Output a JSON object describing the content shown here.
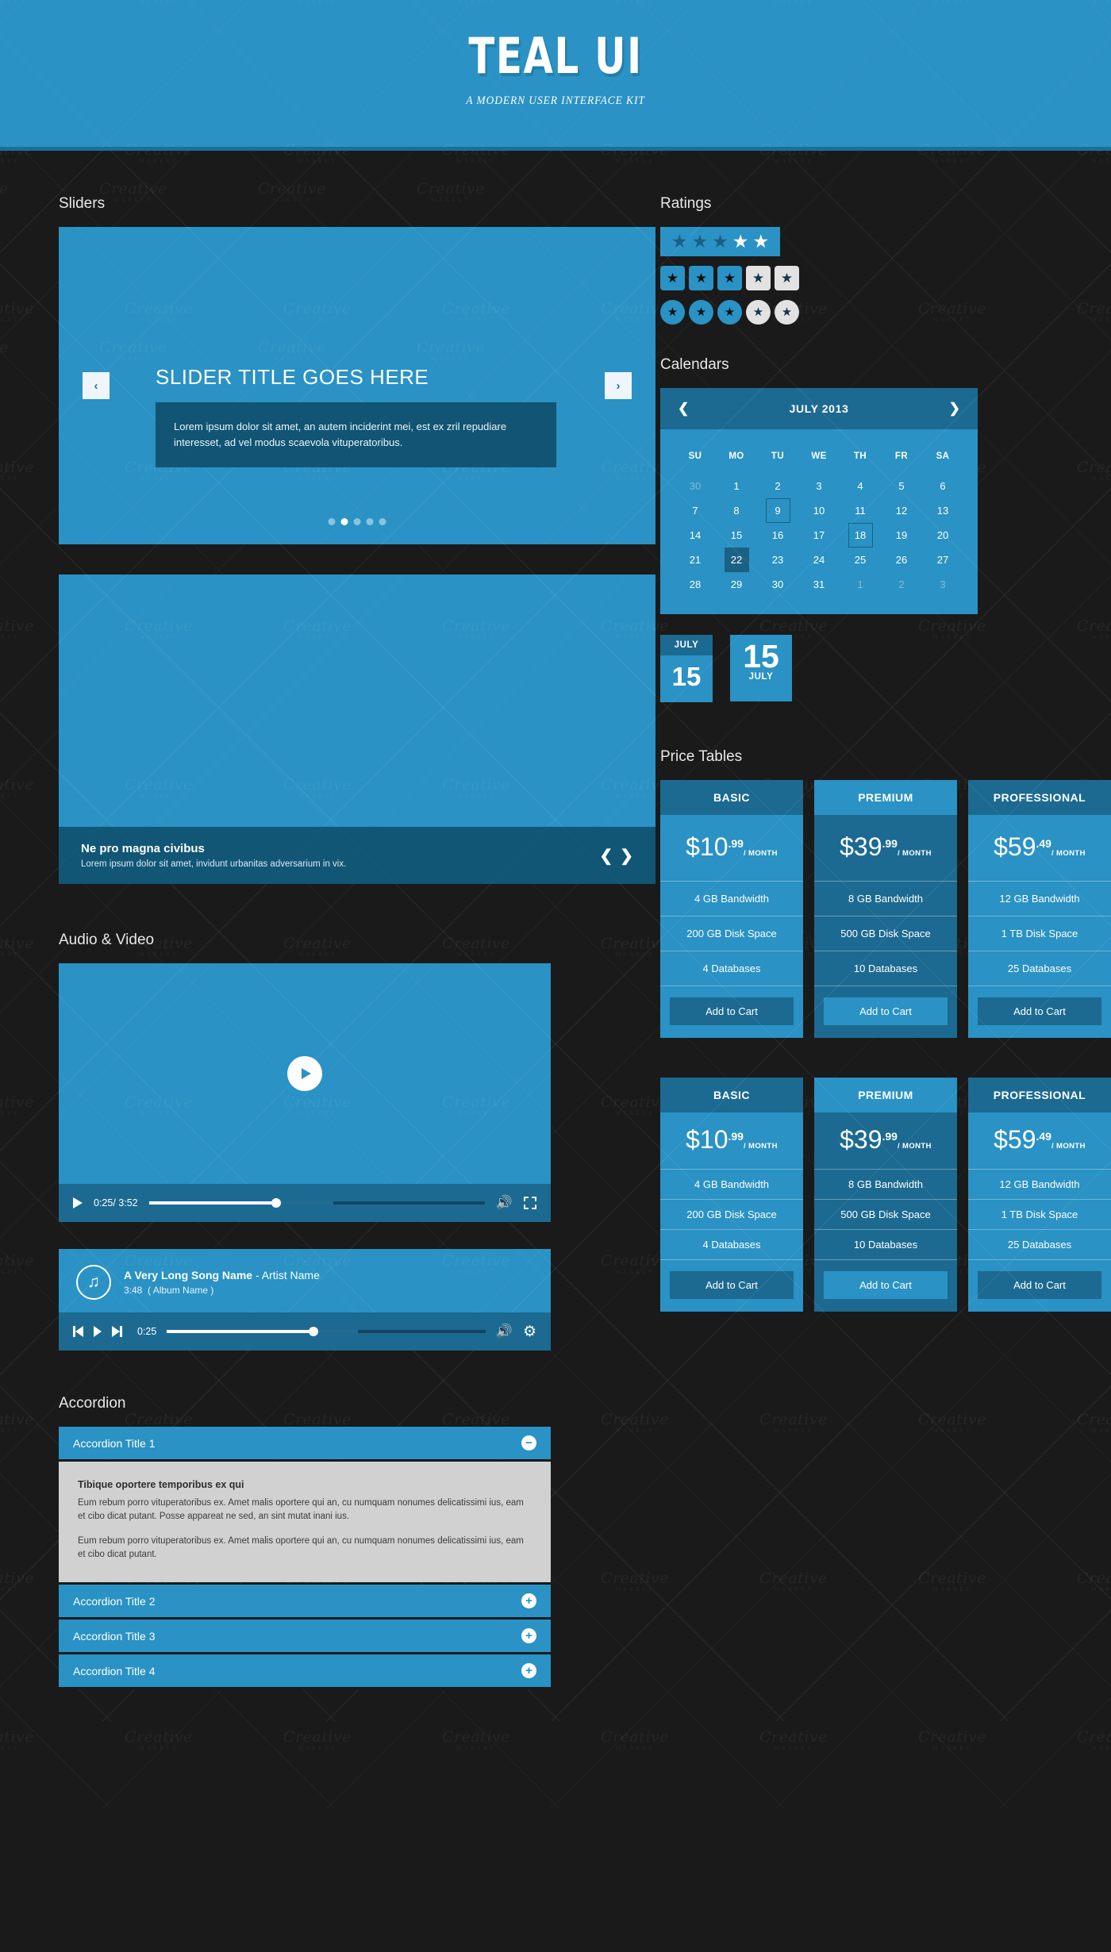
{
  "header": {
    "title": "TEAL UI",
    "subtitle": "A MODERN USER INTERFACE KIT"
  },
  "watermark": {
    "line1": "Creative",
    "line2": "MARKET"
  },
  "colors": {
    "teal": "#2a92c4",
    "teal_dark": "#1c6a91",
    "bg": "#1a1a1a",
    "accordion_body": "#d1d1d1"
  },
  "sections": {
    "sliders": "Sliders",
    "ratings": "Ratings",
    "calendars": "Calendars",
    "audio_video": "Audio & Video",
    "price_tables": "Price Tables",
    "accordion": "Accordion"
  },
  "slider1": {
    "title": "SLIDER TITLE GOES HERE",
    "description": "Lorem ipsum dolor sit amet, an autem inciderint mei, est ex zril repudiare interesset, ad vel modus scaevola vituperatoribus.",
    "prev": "‹",
    "next": "›",
    "dots_count": 5,
    "active_dot": 2
  },
  "slider2": {
    "title": "Ne pro magna civibus",
    "description": "Lorem ipsum dolor sit amet, invidunt urbanitas adversarium in vix.",
    "prev": "❮",
    "next": "❯"
  },
  "ratings": {
    "star_glyph": "★",
    "bar": {
      "total": 5,
      "filled": 3
    },
    "squares": {
      "total": 5,
      "filled": 3
    },
    "circles": {
      "total": 5,
      "filled": 3
    }
  },
  "calendar": {
    "month_label": "JULY 2013",
    "prev": "❮",
    "next": "❯",
    "weekdays": [
      "SU",
      "MO",
      "TU",
      "WE",
      "TH",
      "FR",
      "SA"
    ],
    "weeks": [
      [
        {
          "d": "30",
          "s": "mute"
        },
        {
          "d": "1"
        },
        {
          "d": "2"
        },
        {
          "d": "3"
        },
        {
          "d": "4"
        },
        {
          "d": "5"
        },
        {
          "d": "6"
        }
      ],
      [
        {
          "d": "7"
        },
        {
          "d": "8"
        },
        {
          "d": "9",
          "s": "hov"
        },
        {
          "d": "10"
        },
        {
          "d": "11"
        },
        {
          "d": "12"
        },
        {
          "d": "13"
        }
      ],
      [
        {
          "d": "14"
        },
        {
          "d": "15"
        },
        {
          "d": "16"
        },
        {
          "d": "17"
        },
        {
          "d": "18",
          "s": "hov"
        },
        {
          "d": "19"
        },
        {
          "d": "20"
        }
      ],
      [
        {
          "d": "21"
        },
        {
          "d": "22",
          "s": "sel"
        },
        {
          "d": "23"
        },
        {
          "d": "24"
        },
        {
          "d": "25"
        },
        {
          "d": "26"
        },
        {
          "d": "27"
        }
      ],
      [
        {
          "d": "28"
        },
        {
          "d": "29"
        },
        {
          "d": "30"
        },
        {
          "d": "31"
        },
        {
          "d": "1",
          "s": "mute"
        },
        {
          "d": "2",
          "s": "mute"
        },
        {
          "d": "3",
          "s": "mute"
        }
      ]
    ]
  },
  "date_badges": {
    "badge_a": {
      "month": "JULY",
      "day": "15"
    },
    "badge_b": {
      "day": "15",
      "month": "JULY"
    }
  },
  "video": {
    "play_icon": "play-icon",
    "time": "0:25/ 3:52",
    "progress_percent": 38,
    "buffer_percent": 55,
    "volume_icon": "🔊",
    "fullscreen_icon": "fullscreen-icon"
  },
  "audio": {
    "note_icon": "♫",
    "song_name": "A Very Long Song Name",
    "separator": " - ",
    "artist": "Artist Name",
    "duration": "3:48",
    "album": "( Album Name )",
    "time": "0:25",
    "progress_percent": 46,
    "buffer_percent": 60,
    "volume_icon": "🔊",
    "settings_icon": "⚙"
  },
  "accordion": {
    "items": [
      {
        "title": "Accordion Title 1",
        "sign": "−",
        "open": true
      },
      {
        "title": "Accordion Title 2",
        "sign": "+",
        "open": false
      },
      {
        "title": "Accordion Title 3",
        "sign": "+",
        "open": false
      },
      {
        "title": "Accordion Title 4",
        "sign": "+",
        "open": false
      }
    ],
    "body": {
      "heading": "Tibique oportere temporibus ex qui",
      "p1": "Eum rebum porro vituperatoribus ex. Amet malis oportere qui an, cu numquam nonumes delicatissimi ius, eam et cibo dicat putant. Posse appareat ne sed, an sint mutat inani ius.",
      "p2": "Eum rebum porro vituperatoribus ex. Amet malis oportere qui an, cu numquam nonumes delicatissimi ius, eam et cibo dicat putant."
    }
  },
  "price_tables": {
    "cta": "Add to Cart",
    "per": "/ MONTH",
    "plans": [
      {
        "name": "BASIC",
        "amount": "$10",
        "cents": ".99",
        "style": "normal",
        "features": [
          "4 GB Bandwidth",
          "200 GB Disk Space",
          "4 Databases"
        ]
      },
      {
        "name": "PREMIUM",
        "amount": "$39",
        "cents": ".99",
        "style": "alt",
        "features": [
          "8 GB Bandwidth",
          "500 GB Disk Space",
          "10 Databases"
        ]
      },
      {
        "name": "PROFESSIONAL",
        "amount": "$59",
        "cents": ".49",
        "style": "normal",
        "features": [
          "12 GB Bandwidth",
          "1 TB Disk Space",
          "25 Databases"
        ]
      }
    ],
    "plans_second_row": [
      {
        "name": "BASIC",
        "amount": "$10",
        "cents": ".99",
        "style": "normal",
        "features": [
          "4 GB Bandwidth",
          "200 GB Disk Space",
          "4 Databases"
        ]
      },
      {
        "name": "PREMIUM",
        "amount": "$39",
        "cents": ".99",
        "style": "alt",
        "features": [
          "8 GB Bandwidth",
          "500 GB Disk Space",
          "10 Databases"
        ]
      },
      {
        "name": "PROFESSIONAL",
        "amount": "$59",
        "cents": ".49",
        "style": "normal",
        "features": [
          "12 GB Bandwidth",
          "1 TB Disk Space",
          "25 Databases"
        ]
      }
    ]
  }
}
